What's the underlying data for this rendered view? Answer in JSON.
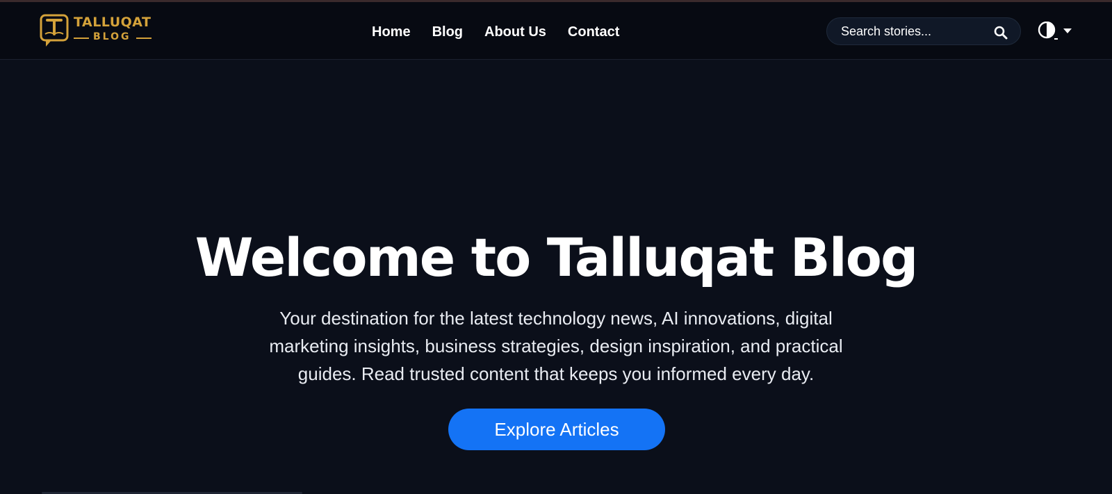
{
  "brand": {
    "name": "TALLUQAT",
    "subtitle": "BLOG",
    "logo_letter": "T",
    "color": "#d4a23a"
  },
  "nav": {
    "items": [
      {
        "label": "Home"
      },
      {
        "label": "Blog"
      },
      {
        "label": "About Us"
      },
      {
        "label": "Contact"
      }
    ]
  },
  "search": {
    "placeholder": "Search stories...",
    "value": "",
    "icon": "search-icon"
  },
  "theme_toggle": {
    "icon": "contrast-icon",
    "dropdown_icon": "caret-down-icon"
  },
  "hero": {
    "title": "Welcome to Talluqat Blog",
    "description": "Your destination for the latest technology news, AI innovations, digital marketing insights, business strategies, design inspiration, and practical guides. Read trusted content that keeps you informed every day.",
    "cta_label": "Explore Articles"
  },
  "colors": {
    "background": "#0b0f1a",
    "header_background": "#070a12",
    "accent": "#1473f5",
    "text": "#ffffff"
  }
}
